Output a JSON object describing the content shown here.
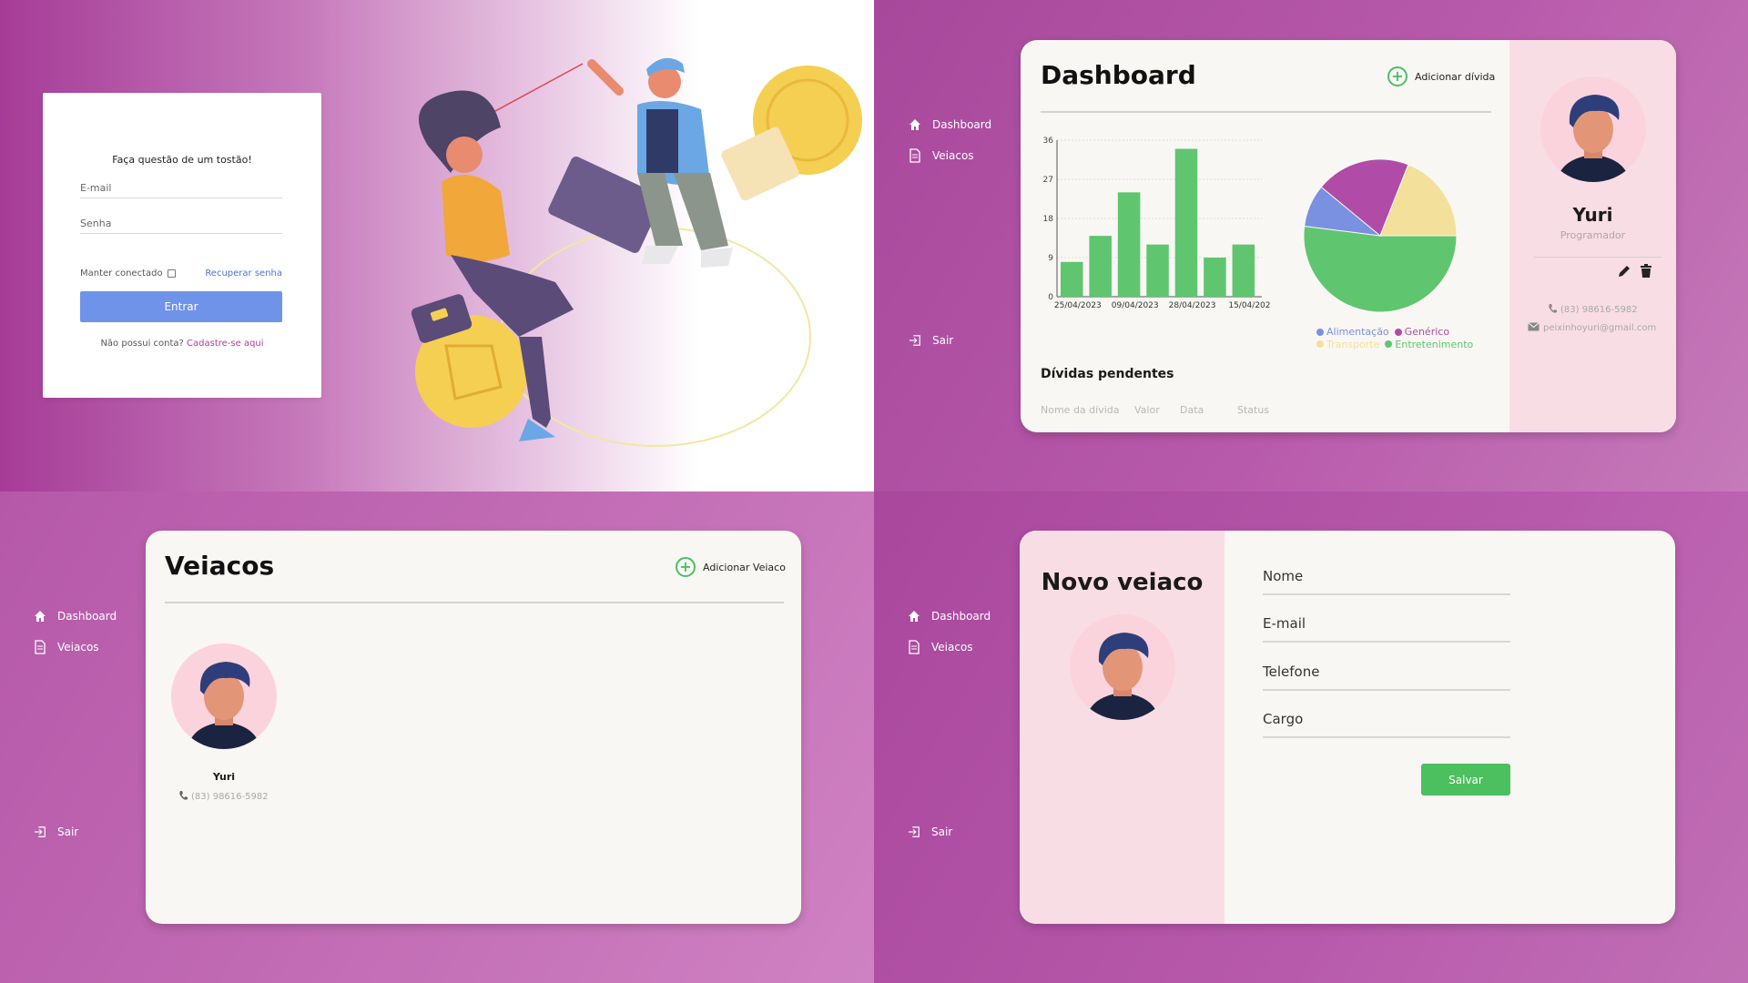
{
  "login": {
    "title": "Faça questão de um tostão!",
    "email_placeholder": "E-mail",
    "password_placeholder": "Senha",
    "remember_label": "Manter conectado",
    "recover_link": "Recuperar senha",
    "submit_label": "Entrar",
    "no_account_text": "Não possui conta?",
    "signup_link": "Cadastre-se aqui"
  },
  "sidebar": {
    "dashboard_label": "Dashboard",
    "veiacos_label": "Veiacos",
    "logout_label": "Sair"
  },
  "dashboard": {
    "title": "Dashboard",
    "add_label": "Adicionar dívida",
    "pending_title": "Dívidas pendentes",
    "table_headers": [
      "Nome da dívida",
      "Valor",
      "Data",
      "Status"
    ],
    "profile": {
      "name": "Yuri",
      "role": "Programador",
      "phone": "(83) 98616-5982",
      "email": "peixinhoyuri@gmail.com"
    }
  },
  "chart_data": [
    {
      "type": "bar",
      "categories": [
        "",
        "25/04/2023",
        "",
        "09/04/2023",
        "",
        "28/04/2023",
        "",
        "15/04/202"
      ],
      "values": [
        8,
        14,
        24,
        12,
        34,
        9,
        12
      ],
      "yticks": [
        "0",
        "9",
        "18",
        "27",
        "36"
      ],
      "ylim": [
        0,
        36
      ],
      "grid": true,
      "color": "#5fc56f"
    },
    {
      "type": "pie",
      "slices": [
        {
          "name": "Entretenimento",
          "value": 52,
          "color": "#5fc56f"
        },
        {
          "name": "Alimentação",
          "value": 9,
          "color": "#7a90e0"
        },
        {
          "name": "Genérico",
          "value": 20,
          "color": "#b04ca8"
        },
        {
          "name": "Transporte",
          "value": 19,
          "color": "#f3e09a"
        }
      ],
      "legend": [
        "Alimentação",
        "Genérico",
        "Transporte",
        "Entretenimento"
      ],
      "legend_position": "bottom"
    }
  ],
  "veiacos": {
    "title": "Veiacos",
    "add_label": "Adicionar Veiaco",
    "card": {
      "name": "Yuri",
      "phone": "(83) 98616-5982"
    }
  },
  "novo": {
    "title": "Novo veiaco",
    "field_nome": "Nome",
    "field_email": "E-mail",
    "field_telefone": "Telefone",
    "field_cargo": "Cargo",
    "save_label": "Salvar"
  },
  "colors": {
    "accent_green": "#4cbf5e",
    "accent_blue": "#6f93e8",
    "accent_pink": "#b03c9c",
    "panel_pink": "#f9dde4"
  }
}
